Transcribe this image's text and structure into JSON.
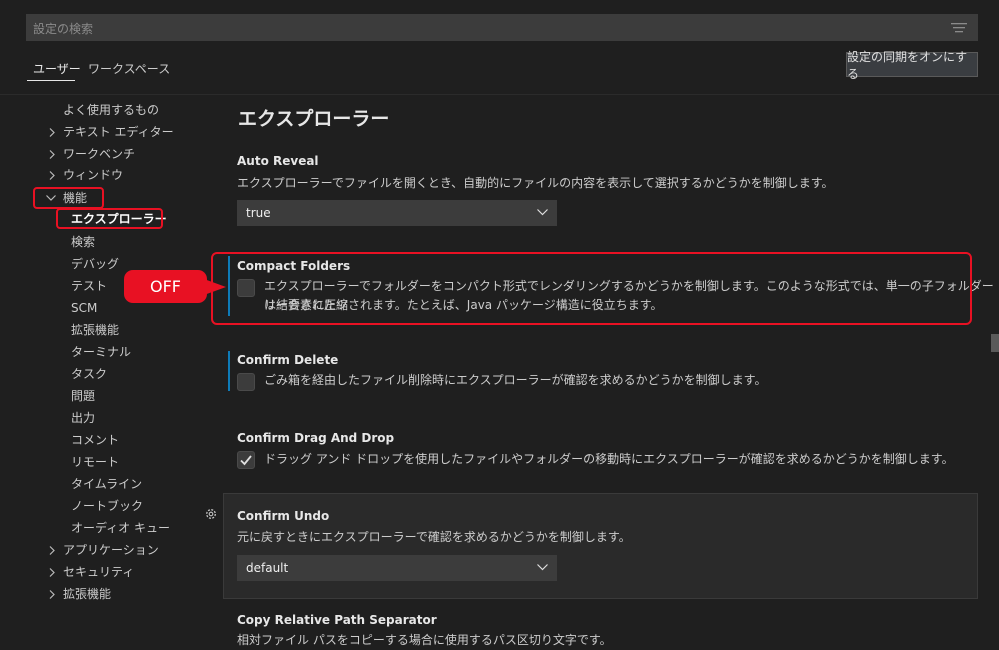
{
  "search": {
    "placeholder": "設定の検索"
  },
  "tabs": {
    "user": "ユーザー",
    "workspace": "ワークスペース"
  },
  "sync_button": "設定の同期をオンにする",
  "sidebar": {
    "items": [
      {
        "label": "よく使用するもの"
      },
      {
        "label": "テキスト エディター"
      },
      {
        "label": "ワークベンチ"
      },
      {
        "label": "ウィンドウ"
      },
      {
        "label": "機能"
      },
      {
        "label": "エクスプローラー"
      },
      {
        "label": "検索"
      },
      {
        "label": "デバッグ"
      },
      {
        "label": "テスト"
      },
      {
        "label": "SCM"
      },
      {
        "label": "拡張機能"
      },
      {
        "label": "ターミナル"
      },
      {
        "label": "タスク"
      },
      {
        "label": "問題"
      },
      {
        "label": "出力"
      },
      {
        "label": "コメント"
      },
      {
        "label": "リモート"
      },
      {
        "label": "タイムライン"
      },
      {
        "label": "ノートブック"
      },
      {
        "label": "オーディオ キュー"
      },
      {
        "label": "アプリケーション"
      },
      {
        "label": "セキュリティ"
      },
      {
        "label": "拡張機能"
      }
    ]
  },
  "main": {
    "section_title": "エクスプローラー",
    "settings": {
      "auto_reveal": {
        "title": "Auto Reveal",
        "description": "エクスプローラーでファイルを開くとき、自動的にファイルの内容を表示して選択するかどうかを制御します。",
        "value": "true"
      },
      "compact_folders": {
        "title": "Compact Folders",
        "description_line1": "エクスプローラーでフォルダーをコンパクト形式でレンダリングするかどうかを制御します。このような形式では、単一の子フォルダーは結合されたツ",
        "description_line2": "リー要素に圧縮されます。たとえば、Java パッケージ構造に役立ちます。",
        "checked": false
      },
      "confirm_delete": {
        "title": "Confirm Delete",
        "description": "ごみ箱を経由したファイル削除時にエクスプローラーが確認を求めるかどうかを制御します。",
        "checked": false
      },
      "confirm_drag_and_drop": {
        "title": "Confirm Drag And Drop",
        "description": "ドラッグ アンド ドロップを使用したファイルやフォルダーの移動時にエクスプローラーが確認を求めるかどうかを制御します。",
        "checked": true
      },
      "confirm_undo": {
        "title": "Confirm Undo",
        "description": "元に戻すときにエクスプローラーで確認を求めるかどうかを制御します。",
        "value": "default"
      },
      "copy_relative_path_separator": {
        "title": "Copy Relative Path Separator",
        "description": "相対ファイル パスをコピーする場合に使用するパス区切り文字です。"
      }
    }
  },
  "annotation": {
    "callout_label": "OFF",
    "color": "#e81123"
  },
  "colors": {
    "background": "#1f1f1f",
    "input": "#3c3c3c",
    "accent_bar": "#0e7bb8",
    "highlight": "#e81123"
  }
}
